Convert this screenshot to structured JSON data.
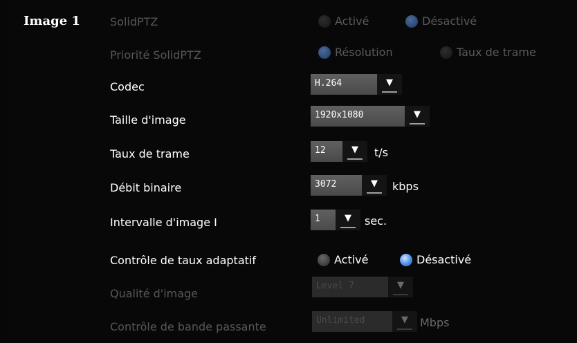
{
  "section_title": "Image 1",
  "solidptz": {
    "label": "SolidPTZ",
    "options": [
      "Activé",
      "Désactivé"
    ],
    "selected": "Désactivé",
    "enabled": false
  },
  "solidptz_priority": {
    "label": "Priorité SolidPTZ",
    "options": [
      "Résolution",
      "Taux de trame"
    ],
    "selected": "Résolution",
    "enabled": false
  },
  "codec": {
    "label": "Codec",
    "value": "H.264"
  },
  "image_size": {
    "label": "Taille d'image",
    "value": "1920x1080"
  },
  "frame_rate": {
    "label": "Taux de trame",
    "value": "12",
    "unit": "t/s"
  },
  "bitrate": {
    "label": "Débit binaire",
    "value": "3072",
    "unit": "kbps"
  },
  "i_frame_interval": {
    "label": "Intervalle d'image I",
    "value": "1",
    "unit": "sec."
  },
  "adaptive_rate": {
    "label": "Contrôle de taux adaptatif",
    "options": [
      "Activé",
      "Désactivé"
    ],
    "selected": "Désactivé",
    "enabled": true
  },
  "image_quality": {
    "label": "Qualité d'image",
    "value": "Level 7",
    "enabled": false
  },
  "bandwidth": {
    "label": "Contrôle de bande passante",
    "value": "Unlimited",
    "unit": "Mbps",
    "enabled": false
  },
  "colors": {
    "accent_blue": "#4e8ee6",
    "background": "#080808",
    "disabled_text": "#575757"
  },
  "icons": {
    "dropdown": "dropdown-arrow-icon",
    "radio": "radio-button-icon"
  }
}
